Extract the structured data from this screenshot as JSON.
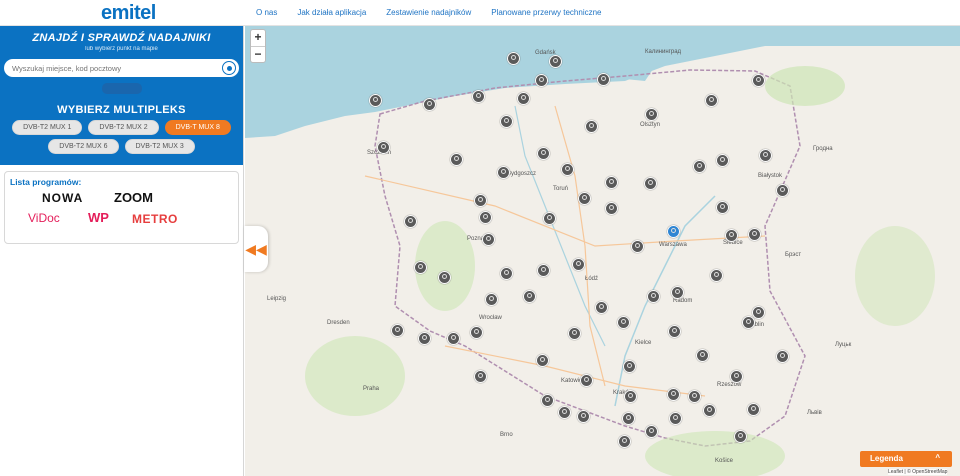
{
  "header": {
    "logo_main": "emitel",
    "nav": [
      "O nas",
      "Jak działa aplikacja",
      "Zestawienie nadajników",
      "Planowane przerwy techniczne"
    ]
  },
  "sidebar": {
    "title": "ZNAJDŹ I SPRAWDŹ NADAJNIKI",
    "subtitle": "lub wybierz punkt na mapie",
    "search_placeholder": "Wyszukaj miejsce, kod pocztowy",
    "mux_title": "WYBIERZ MULTIPLEKS",
    "mux_row1": [
      "DVB-T2 MUX 1",
      "DVB-T2 MUX 2",
      "DVB-T MUX 8"
    ],
    "mux_row2": [
      "DVB-T2 MUX 6",
      "DVB-T2 MUX 3"
    ],
    "active_mux": "DVB-T MUX 8",
    "programs_title": "Lista programów:",
    "programs": [
      "NOWA",
      "ZOOM",
      "ViDoc",
      "WP",
      "METRO"
    ]
  },
  "map": {
    "zoom_in": "+",
    "zoom_out": "−",
    "cities": [
      {
        "name": "Gdańsk"
      },
      {
        "name": "Калининград"
      },
      {
        "name": "Olsztyn"
      },
      {
        "name": "Białystok"
      },
      {
        "name": "Bydgoszcz"
      },
      {
        "name": "Toruń"
      },
      {
        "name": "Szczecin"
      },
      {
        "name": "Poznań"
      },
      {
        "name": "Warszawa"
      },
      {
        "name": "Łódź"
      },
      {
        "name": "Radom"
      },
      {
        "name": "Lublin"
      },
      {
        "name": "Wrocław"
      },
      {
        "name": "Kraków"
      },
      {
        "name": "Katowice"
      },
      {
        "name": "Rzeszów"
      },
      {
        "name": "Praha"
      },
      {
        "name": "Dresden"
      },
      {
        "name": "Brno"
      },
      {
        "name": "Košice"
      },
      {
        "name": "Гродна"
      },
      {
        "name": "Брэст"
      },
      {
        "name": "Луцьк"
      },
      {
        "name": "Львів"
      },
      {
        "name": "Leipzig"
      },
      {
        "name": "Kielce"
      },
      {
        "name": "Siedlce"
      }
    ],
    "accent_color": "#0b72c2",
    "marker_color": "#5a5a5a"
  },
  "legend": {
    "label": "Legenda",
    "chevron": "^"
  },
  "attribution": "Leaflet | © OpenStreetMap"
}
